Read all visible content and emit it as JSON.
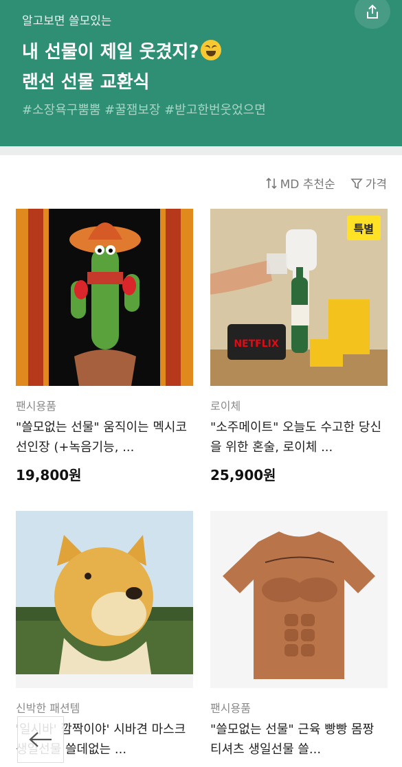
{
  "header": {
    "eyebrow": "알고보면 쓸모있는",
    "title_line1": "내 선물이 제일 웃겼지?",
    "title_line2": "랜선 선물 교환식",
    "tags": "#소장욕구뿜뿜 #꿀잼보장 #받고한번웃었으면"
  },
  "sort": {
    "order_label": "MD 추천순",
    "filter_label": "가격"
  },
  "products": [
    {
      "brand": "팬시용품",
      "name": "\"쓸모없는 선물\" 움직이는 멕시코 선인장 (+녹음기능, ...",
      "price": "19,800원"
    },
    {
      "brand": "로이체",
      "name": "\"소주메이트\" 오늘도 수고한 당신을 위한 혼술, 로이체 ...",
      "price": "25,900원",
      "badge": "특별",
      "img_text": "NETFLIX"
    },
    {
      "brand": "신박한 패션템",
      "name": "'일시바' 깜짝이야' 시바견 마스크 생일선물 쓸데없는 ..."
    },
    {
      "brand": "팬시용품",
      "name": "\"쓸모없는 선물\" 근육 빵빵 몸짱 티셔츠 생일선물 쓸..."
    }
  ],
  "colors": {
    "header_bg": "#2f8f75",
    "badge_bg": "#ffe226"
  }
}
